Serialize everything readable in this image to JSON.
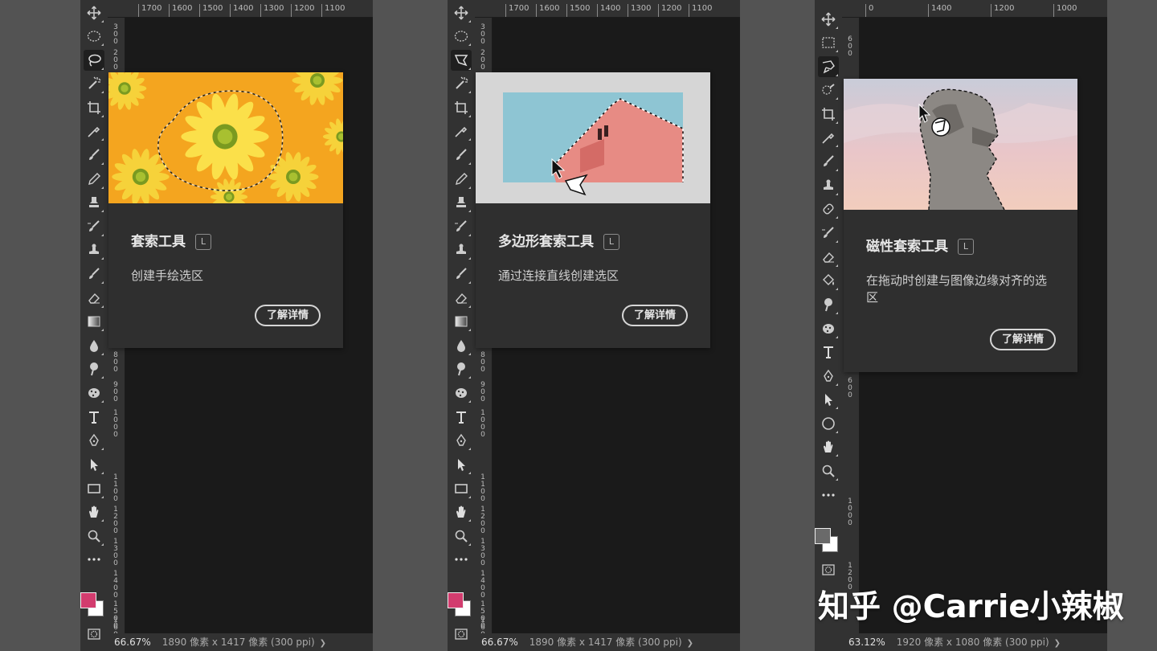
{
  "panels": [
    {
      "id": "lasso",
      "rulers": {
        "h": [
          "1700",
          "1600",
          "1500",
          "1400",
          "1300",
          "1200",
          "1100"
        ],
        "v": [
          "300",
          "200",
          "800",
          "900",
          "1000",
          "1100",
          "1200",
          "1300",
          "1400",
          "1500",
          "1600"
        ]
      },
      "tooltip": {
        "title": "套索工具",
        "shortcut": "L",
        "description": "创建手绘选区",
        "button": "了解详情"
      },
      "status": {
        "zoom": "66.67%",
        "info": "1890 像素 x 1417 像素 (300 ppi)",
        "arrow": "❯"
      },
      "foreground_color": "#d23c6e"
    },
    {
      "id": "polygonal-lasso",
      "rulers": {
        "h": [
          "1700",
          "1600",
          "1500",
          "1400",
          "1300",
          "1200",
          "1100"
        ],
        "v": [
          "300",
          "200",
          "800",
          "900",
          "1000",
          "1100",
          "1200",
          "1300",
          "1400",
          "1500",
          "1600"
        ]
      },
      "tooltip": {
        "title": "多边形套索工具",
        "shortcut": "L",
        "description": "通过连接直线创建选区",
        "button": "了解详情"
      },
      "status": {
        "zoom": "66.67%",
        "info": "1890 像素 x 1417 像素 (300 ppi)",
        "arrow": "❯"
      },
      "foreground_color": "#d23c6e"
    },
    {
      "id": "magnetic-lasso",
      "rulers": {
        "h": [
          "0",
          "1400",
          "1200",
          "1000"
        ],
        "v": [
          "600",
          "600",
          "1000",
          "1200"
        ]
      },
      "tooltip": {
        "title": "磁性套索工具",
        "shortcut": "L",
        "description": "在拖动时创建与图像边缘对齐的选区",
        "button": "了解详情"
      },
      "status": {
        "zoom": "63.12%",
        "info": "1920 像素 x 1080 像素 (300 ppi)",
        "arrow": "❯"
      },
      "foreground_color": "#6a6a6a"
    }
  ],
  "watermark": "知乎 @Carrie小辣椒",
  "colors": {
    "toolbar": "#323232",
    "canvas": "#282828",
    "tooltip": "#2f2f2f",
    "desktop": "#535353"
  },
  "icons": {
    "lasso": "lasso-icon",
    "polygonal_lasso": "polygonal-lasso-icon",
    "magnetic_lasso": "magnetic-lasso-icon"
  }
}
